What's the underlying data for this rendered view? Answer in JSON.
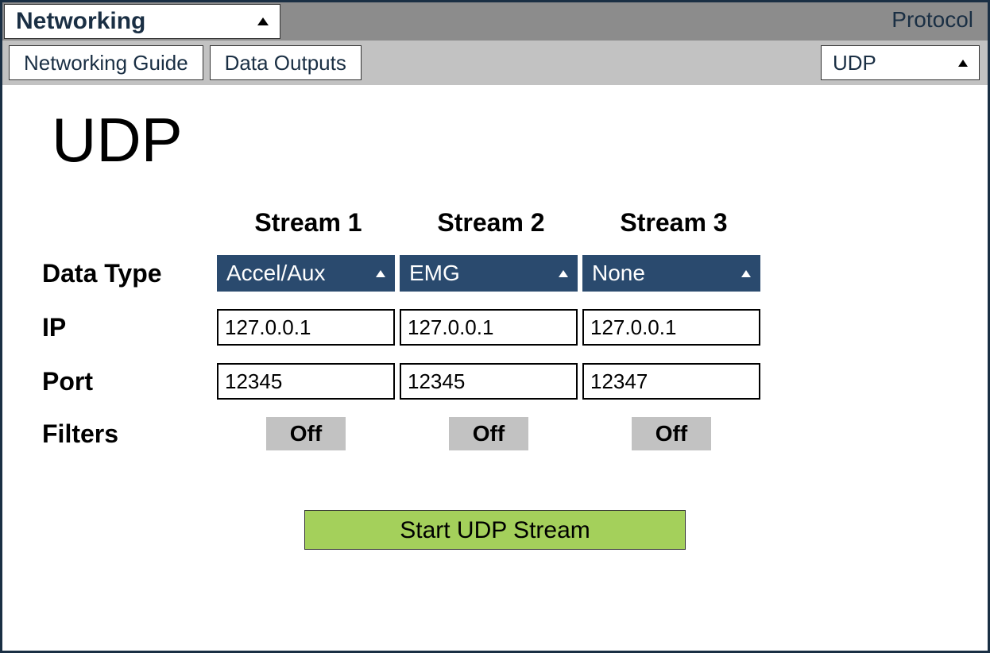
{
  "header": {
    "networking_dropdown": "Networking",
    "protocol_label": "Protocol"
  },
  "subheader": {
    "tabs": [
      {
        "label": "Networking Guide"
      },
      {
        "label": "Data Outputs"
      }
    ],
    "protocol_select": "UDP"
  },
  "main": {
    "title": "UDP",
    "columns": [
      "Stream 1",
      "Stream 2",
      "Stream 3"
    ],
    "rows": {
      "data_type_label": "Data Type",
      "ip_label": "IP",
      "port_label": "Port",
      "filters_label": "Filters"
    },
    "streams": [
      {
        "data_type": "Accel/Aux",
        "ip": "127.0.0.1",
        "port": "12345",
        "filter": "Off"
      },
      {
        "data_type": "EMG",
        "ip": "127.0.0.1",
        "port": "12345",
        "filter": "Off"
      },
      {
        "data_type": "None",
        "ip": "127.0.0.1",
        "port": "12347",
        "filter": "Off"
      }
    ],
    "start_button": "Start UDP Stream"
  }
}
